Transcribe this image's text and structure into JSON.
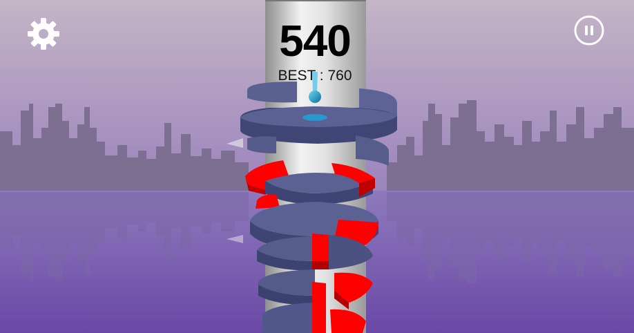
{
  "hud": {
    "score": "540",
    "best_text": "BEST : 760",
    "settings_icon": "gear-icon",
    "pause_icon": "pause-icon"
  },
  "colors": {
    "sky_top": "#c3b6c7",
    "sky_bottom": "#8f72bf",
    "water_top": "#8a75bb",
    "water_bottom": "#6b4aa8",
    "skyline": "#7a6c90",
    "tower": "#d9d9d9",
    "platform_top": "#585f8e",
    "platform_side": "#3d4370",
    "danger": "#ff0000",
    "ball": "#1ea3d6"
  }
}
